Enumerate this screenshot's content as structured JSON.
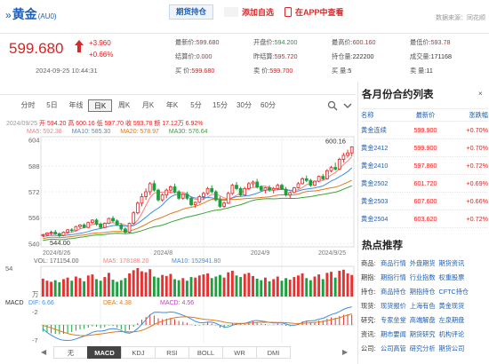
{
  "header": {
    "chevron": "»",
    "name": "黄金",
    "code": "(AU0)",
    "tab_label": "期货持仓",
    "add_favorite": "添加自选",
    "app_link": "在APP中查看",
    "source": "数据来源：同花顺"
  },
  "quote": {
    "price": "599.680",
    "change": "+3.960",
    "change_pct": "+0.66%",
    "timestamp": "2024-09-25 10:44:31",
    "stats": [
      [
        {
          "k": "最新价:",
          "v": "599.680",
          "c": "red"
        },
        {
          "k": "开盘价:",
          "v": "594.200",
          "c": "green"
        },
        {
          "k": "最高价:",
          "v": "600.160",
          "c": "red"
        },
        {
          "k": "最低价:",
          "v": "593.78",
          "c": "red"
        }
      ],
      [
        {
          "k": "结算价:",
          "v": "0.000",
          "c": "red"
        },
        {
          "k": "昨结算:",
          "v": "595.720",
          "c": "red"
        },
        {
          "k": "持仓量:",
          "v": "222200",
          "c": ""
        },
        {
          "k": "成交量:",
          "v": "171168",
          "c": ""
        }
      ],
      [
        {
          "k": "买 价:",
          "v": "599.680",
          "c": "red"
        },
        {
          "k": "卖 价:",
          "v": "599.700",
          "c": "red"
        },
        {
          "k": "买 量:",
          "v": "5",
          "c": ""
        },
        {
          "k": "卖 量:",
          "v": "11",
          "c": ""
        }
      ]
    ]
  },
  "periods": [
    "分时",
    "5日",
    "年线",
    "日K",
    "周K",
    "月K",
    "年K",
    "5分",
    "15分",
    "30分",
    "60分"
  ],
  "active_period": "日K",
  "ohlc": {
    "date": "2024/09/25",
    "open": "开 594.20",
    "high": "高 600.16",
    "low": "低 597.70",
    "close": "收 593.78",
    "amount": "额 17.12万",
    "pct": "6.92%"
  },
  "ma_legend": [
    {
      "label": "MA5: 592.38",
      "color": "#ff7c7c"
    },
    {
      "label": "MA10: 585.30",
      "color": "#3f8fe0"
    },
    {
      "label": "MA20: 578.97",
      "color": "#e07a1c"
    },
    {
      "label": "MA30: 576.64",
      "color": "#3aa33a"
    }
  ],
  "axis": {
    "y_labels": [
      "604",
      "588",
      "572",
      "556",
      "540"
    ],
    "x_labels": [
      "2024/6/26",
      "2024/8",
      "2024/9",
      "2024/9/25"
    ],
    "high_label": "600.16",
    "low_label": "544.00",
    "vol_legend": {
      "vol": "VOL: 171154.00",
      "ma5": "MA5: 178188.20",
      "ma10": "MA10: 152941.80"
    },
    "vol_max": "54",
    "vol_unit": "万",
    "macd_legend": {
      "title": "MACD",
      "dif": "DIF: 6.66",
      "dea": "DEA: 4.38",
      "macd": "MACD: 4.56"
    },
    "macd_top": "-2",
    "macd_bottom": "-7"
  },
  "indicator_tabs": [
    "无",
    "MACD",
    "KDJ",
    "RSI",
    "BOLL",
    "WR",
    "DMI"
  ],
  "active_indicator": "MACD",
  "right": {
    "title": "各月份合约列表",
    "collapse": "×",
    "headers": [
      "名称",
      "最新价",
      "涨跌幅"
    ],
    "contracts": [
      [
        "黄金连续",
        "599.900",
        "+0.70%"
      ],
      [
        "黄金2412",
        "599.900",
        "+0.70%"
      ],
      [
        "黄金2410",
        "597.860",
        "+0.72%"
      ],
      [
        "黄金2502",
        "601.720",
        "+0.69%"
      ],
      [
        "黄金2503",
        "607.600",
        "+0.66%"
      ],
      [
        "黄金2504",
        "603.620",
        "+0.72%"
      ]
    ],
    "hot_title": "热点推荐",
    "hot": [
      {
        "k": "商品:",
        "links": [
          "商品行情",
          "外盘期货",
          "期货资讯"
        ]
      },
      {
        "k": "期指:",
        "links": [
          "期指行情",
          "行业指数",
          "权重股票"
        ]
      },
      {
        "k": "持仓:",
        "links": [
          "商品持仓",
          "期指持仓",
          "CFTC持仓"
        ]
      },
      {
        "k": "现货:",
        "links": [
          "现货报价",
          "上海有色",
          "黄金现货"
        ]
      },
      {
        "k": "研究:",
        "links": [
          "专家坐堂",
          "高端解盘",
          "左泉期盘"
        ]
      },
      {
        "k": "资讯:",
        "links": [
          "期市要闻",
          "期货研究",
          "机构评论"
        ]
      },
      {
        "k": "公司:",
        "links": [
          "公司高管",
          "研究分析",
          "期货公司"
        ]
      }
    ]
  },
  "chart_data": {
    "type": "candlestick",
    "price_range": [
      538,
      606
    ],
    "candles": [
      [
        545,
        546,
        544,
        545.5
      ],
      [
        545.5,
        547,
        544.5,
        546.5
      ],
      [
        546.5,
        548,
        545,
        547
      ],
      [
        547,
        548.5,
        545.5,
        546
      ],
      [
        546,
        547,
        544,
        545
      ],
      [
        545,
        547.5,
        544.5,
        547
      ],
      [
        547,
        549,
        546,
        548.5
      ],
      [
        548.5,
        549.5,
        547,
        548
      ],
      [
        548,
        551,
        547.5,
        550.5
      ],
      [
        550.5,
        552,
        549,
        551.5
      ],
      [
        551.5,
        552.5,
        549.5,
        550
      ],
      [
        550,
        553.5,
        549.5,
        553
      ],
      [
        553,
        555,
        552,
        554.5
      ],
      [
        554.5,
        555.5,
        551,
        552
      ],
      [
        552,
        553,
        549,
        550
      ],
      [
        550,
        553,
        549.5,
        552.5
      ],
      [
        552.5,
        556,
        552,
        555.5
      ],
      [
        555.5,
        557,
        553,
        554
      ],
      [
        554,
        555,
        551,
        551.5
      ],
      [
        551.5,
        552.5,
        548,
        549
      ],
      [
        549,
        550,
        546,
        547
      ],
      [
        547,
        553,
        546.5,
        552.5
      ],
      [
        552.5,
        560,
        552,
        559
      ],
      [
        559,
        566,
        558,
        565
      ],
      [
        565,
        571,
        563,
        569
      ],
      [
        569,
        574,
        567,
        572
      ],
      [
        572,
        578,
        570,
        577
      ],
      [
        577,
        579,
        572,
        573
      ],
      [
        573,
        574,
        566,
        567
      ],
      [
        567,
        571,
        566,
        570
      ],
      [
        570,
        574,
        568,
        573
      ],
      [
        573,
        576,
        571,
        575
      ],
      [
        575,
        577,
        571,
        572
      ],
      [
        572,
        573,
        567,
        568
      ],
      [
        568,
        571,
        567,
        570.5
      ],
      [
        570.5,
        572,
        567,
        568
      ],
      [
        568,
        569,
        563,
        564
      ],
      [
        564,
        566,
        562,
        565.5
      ],
      [
        565.5,
        570,
        565,
        569
      ],
      [
        569,
        572,
        567,
        571
      ],
      [
        571,
        575,
        570,
        574
      ],
      [
        574,
        576,
        571,
        572
      ],
      [
        572,
        573,
        566,
        567
      ],
      [
        567,
        569,
        562,
        563
      ],
      [
        563,
        566,
        562,
        565
      ],
      [
        565,
        572,
        564.5,
        571
      ],
      [
        571,
        577,
        570,
        576
      ],
      [
        576,
        578,
        573,
        574
      ],
      [
        574,
        575,
        569,
        570
      ],
      [
        570,
        575,
        569.5,
        574
      ],
      [
        574,
        578,
        573,
        577
      ],
      [
        577,
        579,
        575,
        578
      ],
      [
        578,
        580,
        574,
        575
      ],
      [
        575,
        576,
        572,
        573
      ],
      [
        573,
        575,
        571,
        574.5
      ],
      [
        574.5,
        576,
        572,
        573
      ],
      [
        573,
        575,
        571,
        574
      ],
      [
        574,
        577,
        573,
        576
      ],
      [
        576,
        577,
        573,
        573.5
      ],
      [
        573.5,
        575,
        569,
        570
      ],
      [
        570,
        572,
        568,
        571.5
      ],
      [
        571.5,
        575,
        571,
        574.5
      ],
      [
        574.5,
        578,
        574,
        577
      ],
      [
        577,
        581,
        576.5,
        580
      ],
      [
        580,
        582,
        578,
        579
      ],
      [
        579,
        580,
        575,
        576
      ],
      [
        576,
        579,
        575.5,
        578.5
      ],
      [
        578.5,
        582,
        578,
        581.5
      ],
      [
        581.5,
        583,
        579,
        580
      ],
      [
        580,
        586,
        579.5,
        585
      ],
      [
        585,
        588,
        584,
        587
      ],
      [
        587,
        590,
        585,
        586
      ],
      [
        586,
        593,
        585.5,
        592
      ],
      [
        592,
        596,
        590,
        594.5
      ],
      [
        594.5,
        598,
        593,
        596
      ],
      [
        596,
        600.16,
        594,
        599.7
      ]
    ],
    "volume": [
      34,
      30,
      28,
      31,
      27,
      33,
      36,
      30,
      38,
      35,
      29,
      40,
      42,
      33,
      30,
      37,
      45,
      32,
      28,
      31,
      35,
      44,
      50,
      54,
      48,
      46,
      52,
      38,
      36,
      41,
      39,
      43,
      33,
      31,
      35,
      30,
      37,
      36,
      40,
      42,
      44,
      35,
      38,
      41,
      36,
      46,
      49,
      40,
      37,
      43,
      45,
      39,
      34,
      31,
      36,
      29,
      33,
      38,
      30,
      35,
      32,
      37,
      40,
      44,
      35,
      31,
      38,
      42,
      33,
      45,
      47,
      36,
      49,
      51,
      44,
      41
    ],
    "macd": [
      -3,
      -3.5,
      -3.8,
      -4,
      -4.2,
      -4,
      -3.6,
      -3.2,
      -2.6,
      -2,
      -1.8,
      -1.2,
      -0.6,
      -0.8,
      -1.4,
      -1,
      -0.2,
      -0.5,
      -1.2,
      -2,
      -2.8,
      -2.2,
      -0.8,
      0.8,
      2.4,
      3.6,
      4.8,
      4.2,
      3,
      2.6,
      2.8,
      3.2,
      2.6,
      1.8,
      1.4,
      1,
      0.2,
      -0.4,
      -0.2,
      0.4,
      1,
      0.6,
      -0.2,
      -1.2,
      -1.4,
      -0.4,
      0.8,
      0.9,
      0.4,
      0.6,
      1.2,
      1.6,
      1.2,
      0.6,
      0.4,
      0.1,
      0.2,
      0.6,
      0.4,
      -0.4,
      -0.6,
      -0.2,
      0.6,
      1.6,
      1.6,
      1,
      1.2,
      2,
      2,
      2.8,
      3.4,
      3.2,
      4,
      4.6,
      4.8,
      4.56
    ],
    "macd_range": [
      -8,
      8
    ]
  }
}
